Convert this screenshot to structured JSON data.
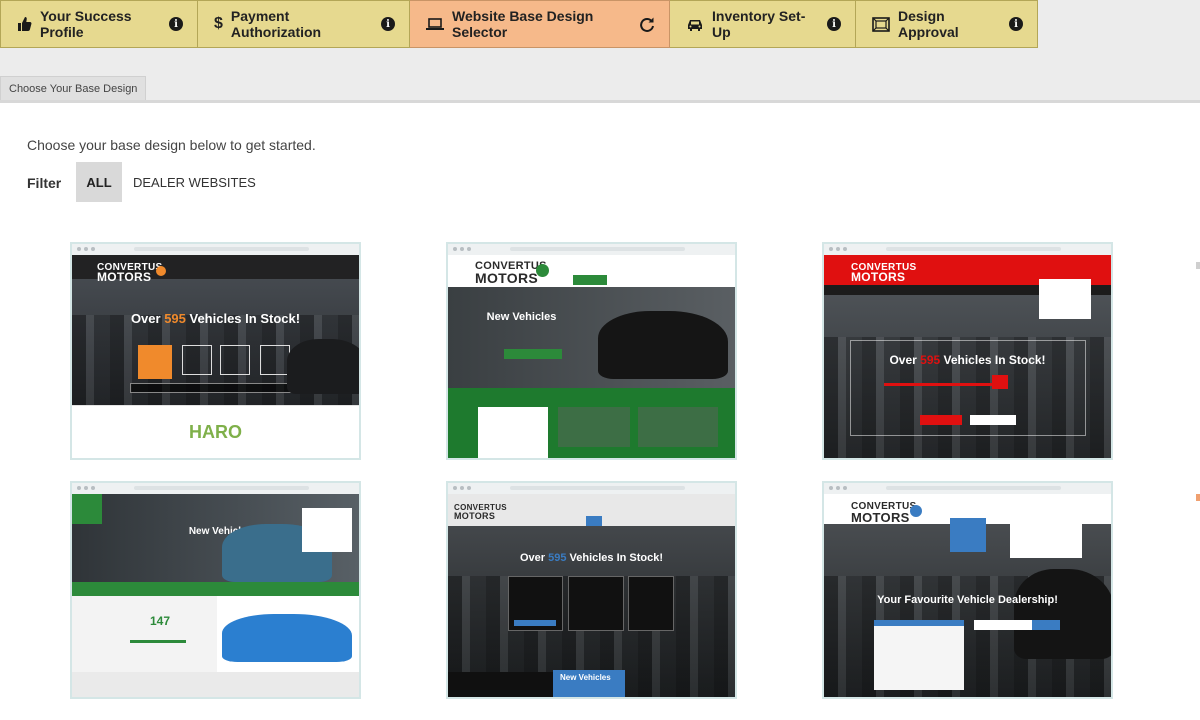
{
  "steps": [
    {
      "label": "Your Success Profile",
      "icon": "thumbs-up-icon",
      "trailing_icon": "info-icon",
      "active": false
    },
    {
      "label": "Payment Authorization",
      "icon": "dollar-icon",
      "trailing_icon": "info-icon",
      "active": false
    },
    {
      "label": "Website Base Design Selector",
      "icon": "laptop-icon",
      "trailing_icon": "refresh-icon",
      "active": true
    },
    {
      "label": "Inventory Set-Up",
      "icon": "car-icon",
      "trailing_icon": "info-icon",
      "active": false
    },
    {
      "label": "Design Approval",
      "icon": "frame-icon",
      "trailing_icon": "info-icon",
      "active": false
    }
  ],
  "subtab": "Choose Your Base Design",
  "intro": "Choose your base design below to get started.",
  "filter": {
    "label": "Filter",
    "options": [
      "ALL",
      "DEALER WEBSITES"
    ],
    "selected": "ALL"
  },
  "designs": [
    {
      "caption": "HARO",
      "logo_top": "CONVERTUS",
      "logo_bottom": "MOTORS",
      "headline_pre": "Over ",
      "headline_num": "595",
      "headline_post": " Vehicles In Stock!"
    },
    {
      "logo_top": "CONVERTUS",
      "logo_bottom": "MOTORS",
      "headline": "New Vehicles"
    },
    {
      "logo_top": "CONVERTUS",
      "logo_bottom": "MOTORS",
      "headline_pre": "Over ",
      "headline_num": "595",
      "headline_post": " Vehicles In Stock!"
    },
    {
      "headline": "New Vehicles",
      "value": "147"
    },
    {
      "logo_top": "CONVERTUS",
      "logo_bottom": "MOTORS",
      "headline_pre": "Over ",
      "headline_num": "595",
      "headline_post": " Vehicles In Stock!",
      "sub": "New Vehicles"
    },
    {
      "logo_top": "CONVERTUS",
      "logo_bottom": "MOTORS",
      "headline": "Your Favourite Vehicle Dealership!"
    }
  ],
  "colors": {
    "step_bg": "#e6d98f",
    "step_active_bg": "#f6b98a",
    "caption_green": "#7fb04a",
    "brand_orange": "#f08a2c",
    "brand_green": "#2c8a3a",
    "brand_red": "#e01010",
    "brand_blue": "#3a7cc2"
  }
}
